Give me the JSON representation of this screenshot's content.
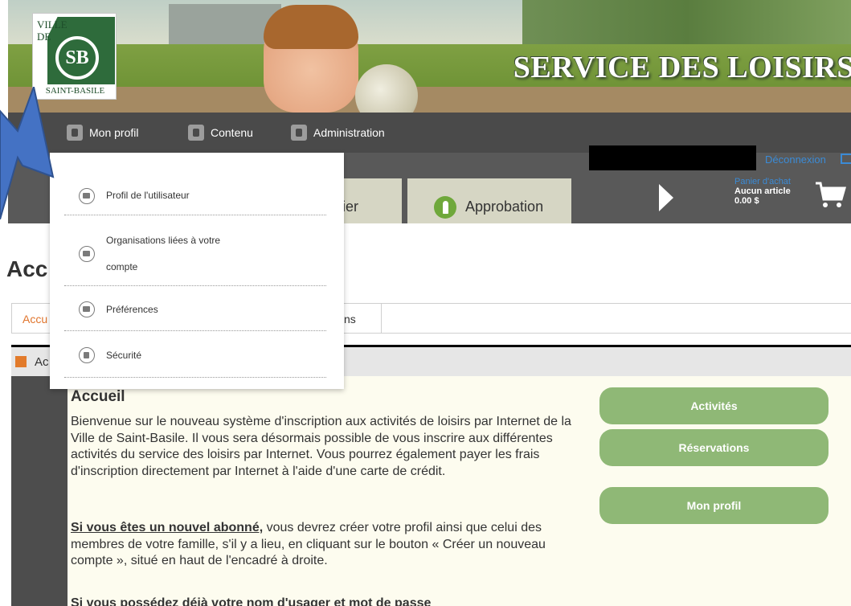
{
  "header": {
    "logo": {
      "ville": "VILLE",
      "de": "DE",
      "city": "SAINT-BASILE",
      "seal": "SB"
    },
    "title": "SERVICE DES LOISIRS"
  },
  "mainnav": {
    "items": [
      {
        "label": "Mon profil",
        "icon": "user-icon"
      },
      {
        "label": "Contenu",
        "icon": "content-icon"
      },
      {
        "label": "Administration",
        "icon": "admin-icon"
      }
    ]
  },
  "topright": {
    "logout": "Déconnexion"
  },
  "tabs": {
    "calendar_partial": "drier",
    "approbation": "Approbation"
  },
  "cart": {
    "title": "Panier d'achat",
    "items": "Aucun article",
    "total": "0.00 $"
  },
  "page": {
    "title_partial": "Acc",
    "tab1_partial": "Accu",
    "tab2_partial": "ns",
    "panel_head_partial": "Ac"
  },
  "dropdown": {
    "items": [
      {
        "label": "Profil de l'utilisateur"
      },
      {
        "label_line1": "Organisations liées à votre",
        "label_line2": "compte"
      },
      {
        "label": "Préférences"
      },
      {
        "label": "Sécurité"
      }
    ]
  },
  "content": {
    "title": "Accueil",
    "p1": "Bienvenue sur le nouveau système d'inscription aux activités de loisirs par Internet de la Ville de Saint-Basile. Il vous sera désormais possible de vous inscrire aux différentes activités du service des loisirs par Internet. Vous pourrez également payer les frais d'inscription directement par Internet à l'aide d'une carte de crédit.",
    "p2_bold": "Si vous êtes un nouvel abonné,",
    "p2_rest": " vous devrez créer votre profil ainsi que celui des membres de votre famille, s'il y a lieu, en cliquant sur le bouton « Créer un nouveau compte », situé en haut de l'encadré à droite.",
    "p3": "Si vous possédez déjà votre nom d'usager et mot de passe"
  },
  "buttons": {
    "activites": "Activités",
    "reservations": "Réservations",
    "monprofil": "Mon profil"
  },
  "colors": {
    "accent_orange": "#e0752d",
    "green_button": "#8fb876",
    "nav_dark": "#4a4a4a",
    "link_blue": "#3b8bd6"
  }
}
